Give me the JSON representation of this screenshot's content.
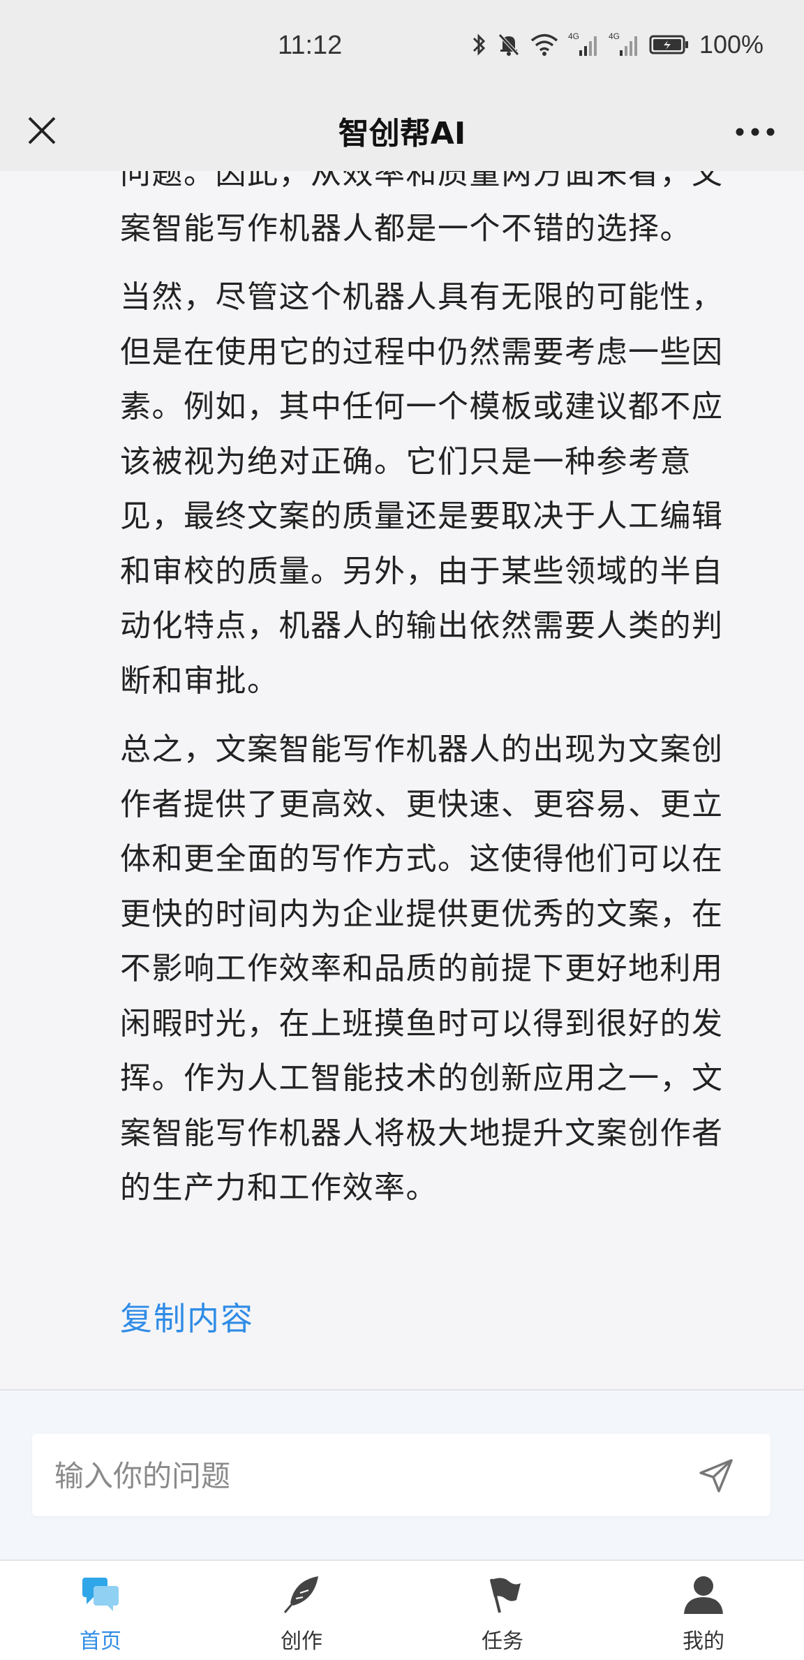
{
  "status_bar": {
    "time": "11:12",
    "network_1": "4G",
    "network_2": "4G",
    "battery": "100%"
  },
  "nav": {
    "title": "智创帮AI",
    "close_icon": "close-icon",
    "more_icon": "more-icon"
  },
  "article": {
    "paragraphs": [
      "问题。因此，从效率和质量两方面来看，文案智能写作机器人都是一个不错的选择。",
      "当然，尽管这个机器人具有无限的可能性，但是在使用它的过程中仍然需要考虑一些因素。例如，其中任何一个模板或建议都不应该被视为绝对正确。它们只是一种参考意见，最终文案的质量还是要取决于人工编辑和审校的质量。另外，由于某些领域的半自动化特点，机器人的输出依然需要人类的判断和审批。",
      "总之，文案智能写作机器人的出现为文案创作者提供了更高效、更快速、更容易、更立体和更全面的写作方式。这使得他们可以在更快的时间内为企业提供更优秀的文案，在不影响工作效率和品质的前提下更好地利用闲暇时光，在上班摸鱼时可以得到很好的发挥。作为人工智能技术的创新应用之一，文案智能写作机器人将极大地提升文案创作者的生产力和工作效率。"
    ],
    "copy_label": "复制内容"
  },
  "input": {
    "placeholder": "输入你的问题",
    "value": "",
    "send_icon": "send-icon"
  },
  "tabs": [
    {
      "label": "首页",
      "icon": "chat-icon",
      "active": true
    },
    {
      "label": "创作",
      "icon": "feather-icon",
      "active": false
    },
    {
      "label": "任务",
      "icon": "flag-icon",
      "active": false
    },
    {
      "label": "我的",
      "icon": "user-icon",
      "active": false
    }
  ],
  "colors": {
    "accent": "#2f8ce6",
    "background": "#f5f5f7",
    "header": "#ededed"
  }
}
